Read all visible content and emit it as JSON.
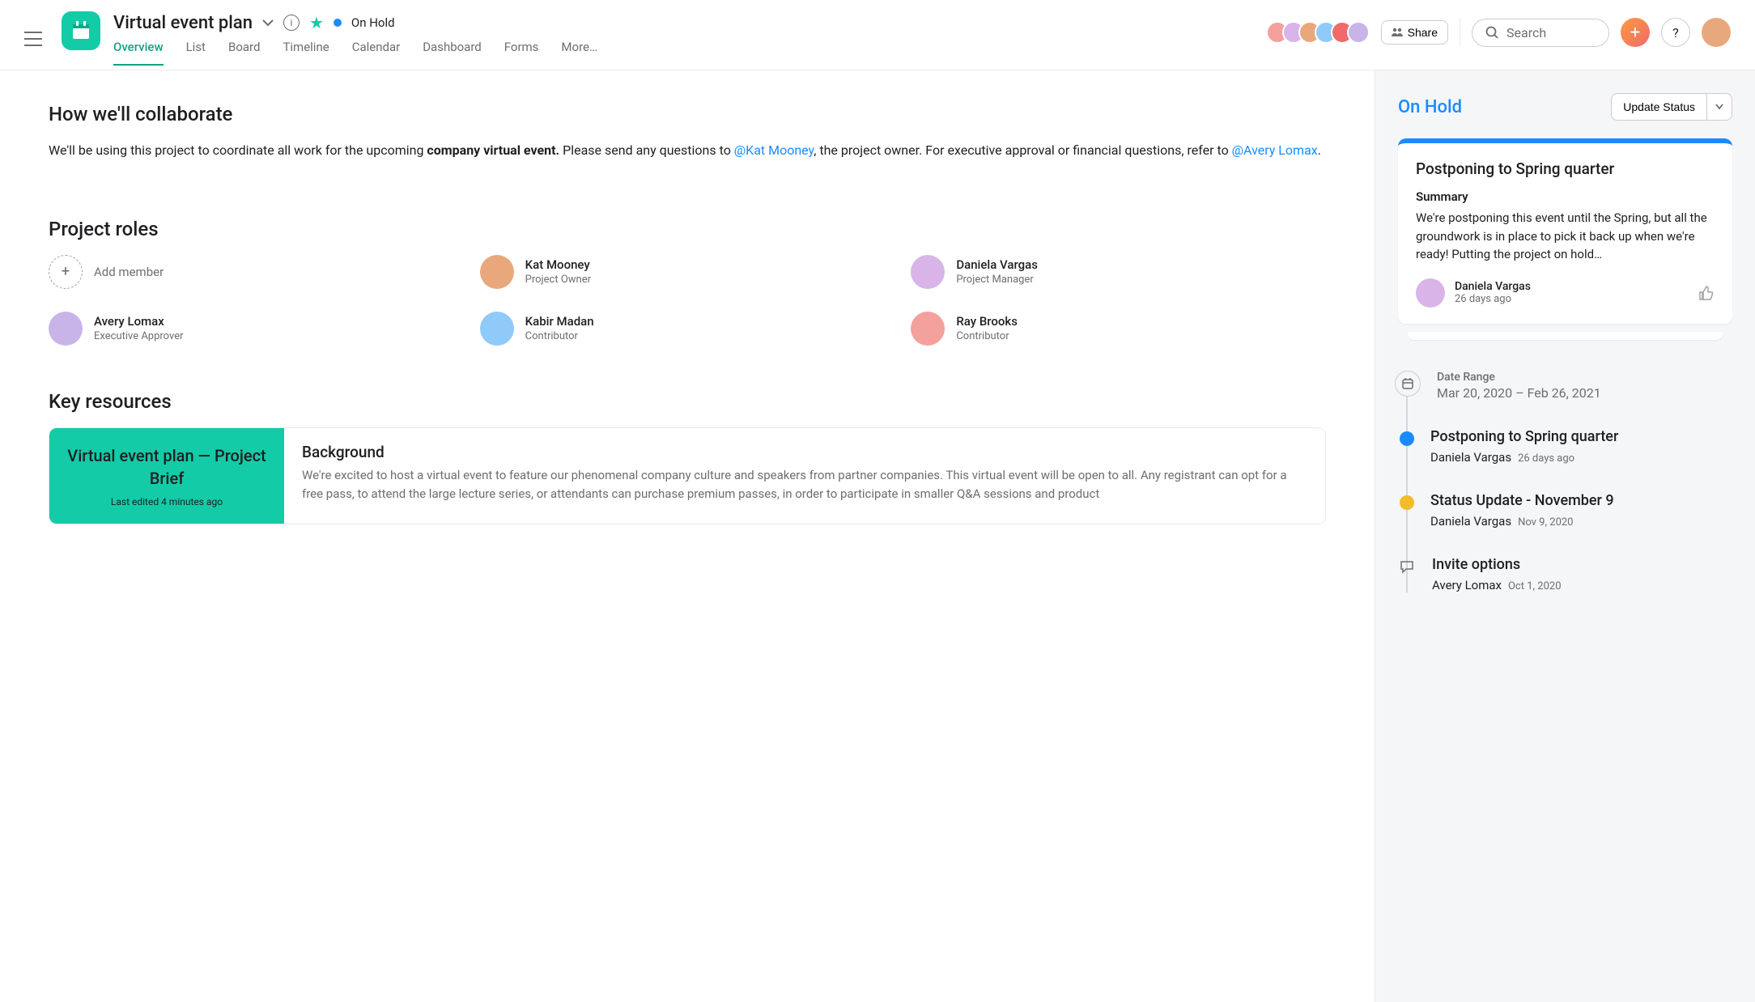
{
  "header": {
    "title": "Virtual event plan",
    "status_label": "On Hold",
    "share_label": "Share",
    "search_placeholder": "Search"
  },
  "tabs": [
    "Overview",
    "List",
    "Board",
    "Timeline",
    "Calendar",
    "Dashboard",
    "Forms",
    "More…"
  ],
  "active_tab": 0,
  "collab": {
    "heading": "How we'll collaborate",
    "body_1": "We'll be using this project to coordinate all work for the upcoming ",
    "body_bold": "company virtual event.",
    "body_2": " Please send any questions to ",
    "mention_1": "@Kat Mooney",
    "body_3": ", the project owner. For executive approval or financial questions, refer to ",
    "mention_2": "@Avery Lomax",
    "body_4": "."
  },
  "roles": {
    "heading": "Project roles",
    "add_label": "Add member",
    "members": [
      {
        "name": "Kat Mooney",
        "role": "Project Owner",
        "color": "#e8a87c"
      },
      {
        "name": "Daniela Vargas",
        "role": "Project Manager",
        "color": "#d8b4e8"
      },
      {
        "name": "Avery Lomax",
        "role": "Executive Approver",
        "color": "#c9b4e8"
      },
      {
        "name": "Kabir Madan",
        "role": "Contributor",
        "color": "#90caf9"
      },
      {
        "name": "Ray Brooks",
        "role": "Contributor",
        "color": "#f4a09c"
      }
    ]
  },
  "resources": {
    "heading": "Key resources",
    "thumb_title": "Virtual event plan — Project Brief",
    "thumb_sub": "Last edited 4 minutes ago",
    "body_title": "Background",
    "body_text": "We're excited to host a virtual event to feature our phenomenal company culture and speakers from partner companies. This virtual event will be open to all. Any registrant can opt for a free pass, to attend the large lecture series, or attendants can purchase premium passes, in order to participate in smaller Q&A sessions and product"
  },
  "sidebar": {
    "status": "On Hold",
    "update_label": "Update Status",
    "card": {
      "title": "Postponing to Spring quarter",
      "summary_label": "Summary",
      "summary_text": "We're postponing this event until the Spring, but all the groundwork is in place to pick it back up when we're ready! Putting the project on hold…",
      "author": "Daniela Vargas",
      "time": "26 days ago"
    },
    "timeline": {
      "date_range_label": "Date Range",
      "date_range_value": "Mar 20, 2020 – Feb 26, 2021",
      "items": [
        {
          "type": "blue",
          "title": "Postponing to Spring quarter",
          "author": "Daniela Vargas",
          "time": "26 days ago"
        },
        {
          "type": "yellow",
          "title": "Status Update - November 9",
          "author": "Daniela Vargas",
          "time": "Nov 9, 2020"
        },
        {
          "type": "chat",
          "title": "Invite options",
          "author": "Avery Lomax",
          "time": "Oct 1, 2020"
        }
      ]
    }
  },
  "avatar_colors": [
    "#f4a09c",
    "#d8b4e8",
    "#e8a87c",
    "#90caf9",
    "#f06a6a",
    "#c9b4e8"
  ]
}
